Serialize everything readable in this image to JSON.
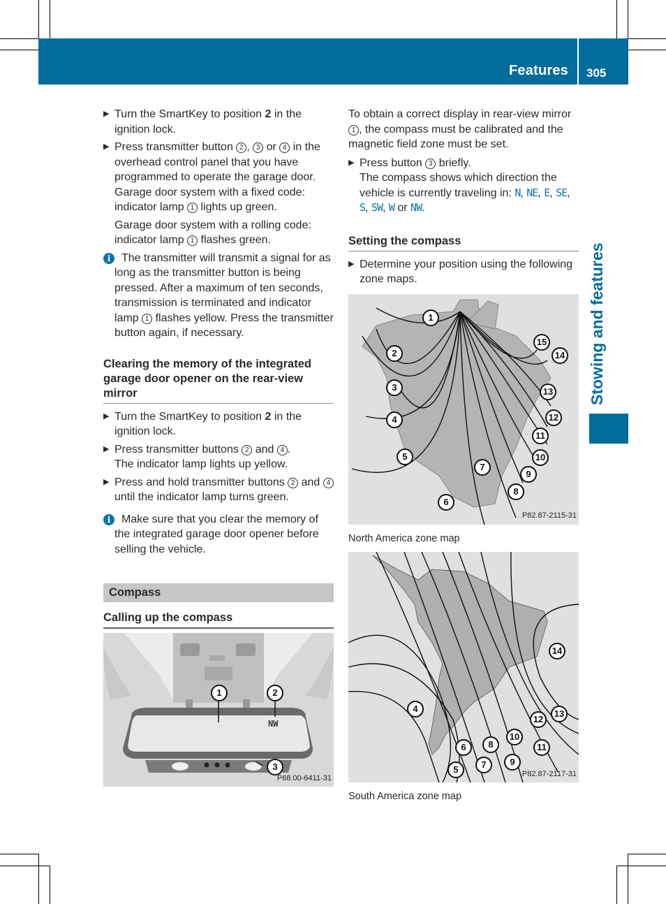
{
  "header": {
    "section_title": "Features",
    "page_number": "305",
    "chapter_tab": "Stowing and features",
    "accent_color": "#026c9d"
  },
  "left_column": {
    "steps_1": [
      {
        "pre": "Turn the SmartKey to position ",
        "bold": "2",
        "post": " in the ignition lock."
      },
      {
        "text": "Press transmitter button ",
        "refs": [
          "2",
          "3",
          "4"
        ],
        "post": " in the overhead control panel that you have programmed to operate the garage door. Garage door system with a fixed code: indicator lamp ",
        "ref_lamp": "1",
        "post2": " lights up green."
      }
    ],
    "rolling_code": {
      "pre": "Garage door system with a rolling code: indicator lamp ",
      "ref": "1",
      "post": " flashes green."
    },
    "info_1": {
      "pre": "The transmitter will transmit a signal for as long as the transmitter button is being pressed. After a maximum of ten seconds, transmission is terminated and indicator lamp ",
      "ref": "1",
      "post": " flashes yellow. Press the transmitter button again, if necessary."
    },
    "heading_clear": "Clearing the memory of the integrated garage door opener on the rear-view mirror",
    "steps_2": [
      {
        "pre": "Turn the SmartKey to position ",
        "bold": "2",
        "post": " in the ignition lock."
      },
      {
        "pre": "Press transmitter buttons ",
        "ref1": "2",
        "mid": " and ",
        "ref2": "4",
        "post": ".",
        "result": "The indicator lamp lights up yellow."
      },
      {
        "pre": "Press and hold transmitter buttons ",
        "ref1": "2",
        "mid": " and ",
        "ref2": "4",
        "post": " until the indicator lamp turns green."
      }
    ],
    "info_2": "Make sure that you clear the memory of the integrated garage door opener before selling the vehicle.",
    "section_bar": "Compass",
    "heading_calling": "Calling up the compass",
    "mirror_figure": {
      "code": "P68.00-6411-31",
      "display_text": "NW",
      "callouts": [
        "1",
        "2",
        "3"
      ]
    }
  },
  "right_column": {
    "intro": {
      "pre": "To obtain a correct display in rear-view mirror ",
      "ref": "1",
      "post": ", the compass must be calibrated and the magnetic field zone must be set."
    },
    "step_press": {
      "pre": "Press button ",
      "ref": "3",
      "post": " briefly."
    },
    "result_pre": "The compass shows which direction the vehicle is currently traveling in: ",
    "directions": [
      "N",
      "NE",
      "E",
      "SE",
      "S",
      "SW",
      "W",
      "NW"
    ],
    "dir_or": "or",
    "heading_setting": "Setting the compass",
    "step_determine": "Determine your position using the following zone maps.",
    "na_map": {
      "code": "P82.87-2115-31",
      "caption": "North America zone map",
      "zones": [
        "1",
        "2",
        "3",
        "4",
        "5",
        "6",
        "7",
        "8",
        "9",
        "10",
        "11",
        "12",
        "13",
        "14",
        "15"
      ]
    },
    "sa_map": {
      "code": "P82.87-2117-31",
      "caption": "South America zone map",
      "zones": [
        "4",
        "5",
        "6",
        "7",
        "8",
        "9",
        "10",
        "11",
        "12",
        "13",
        "14"
      ]
    }
  }
}
